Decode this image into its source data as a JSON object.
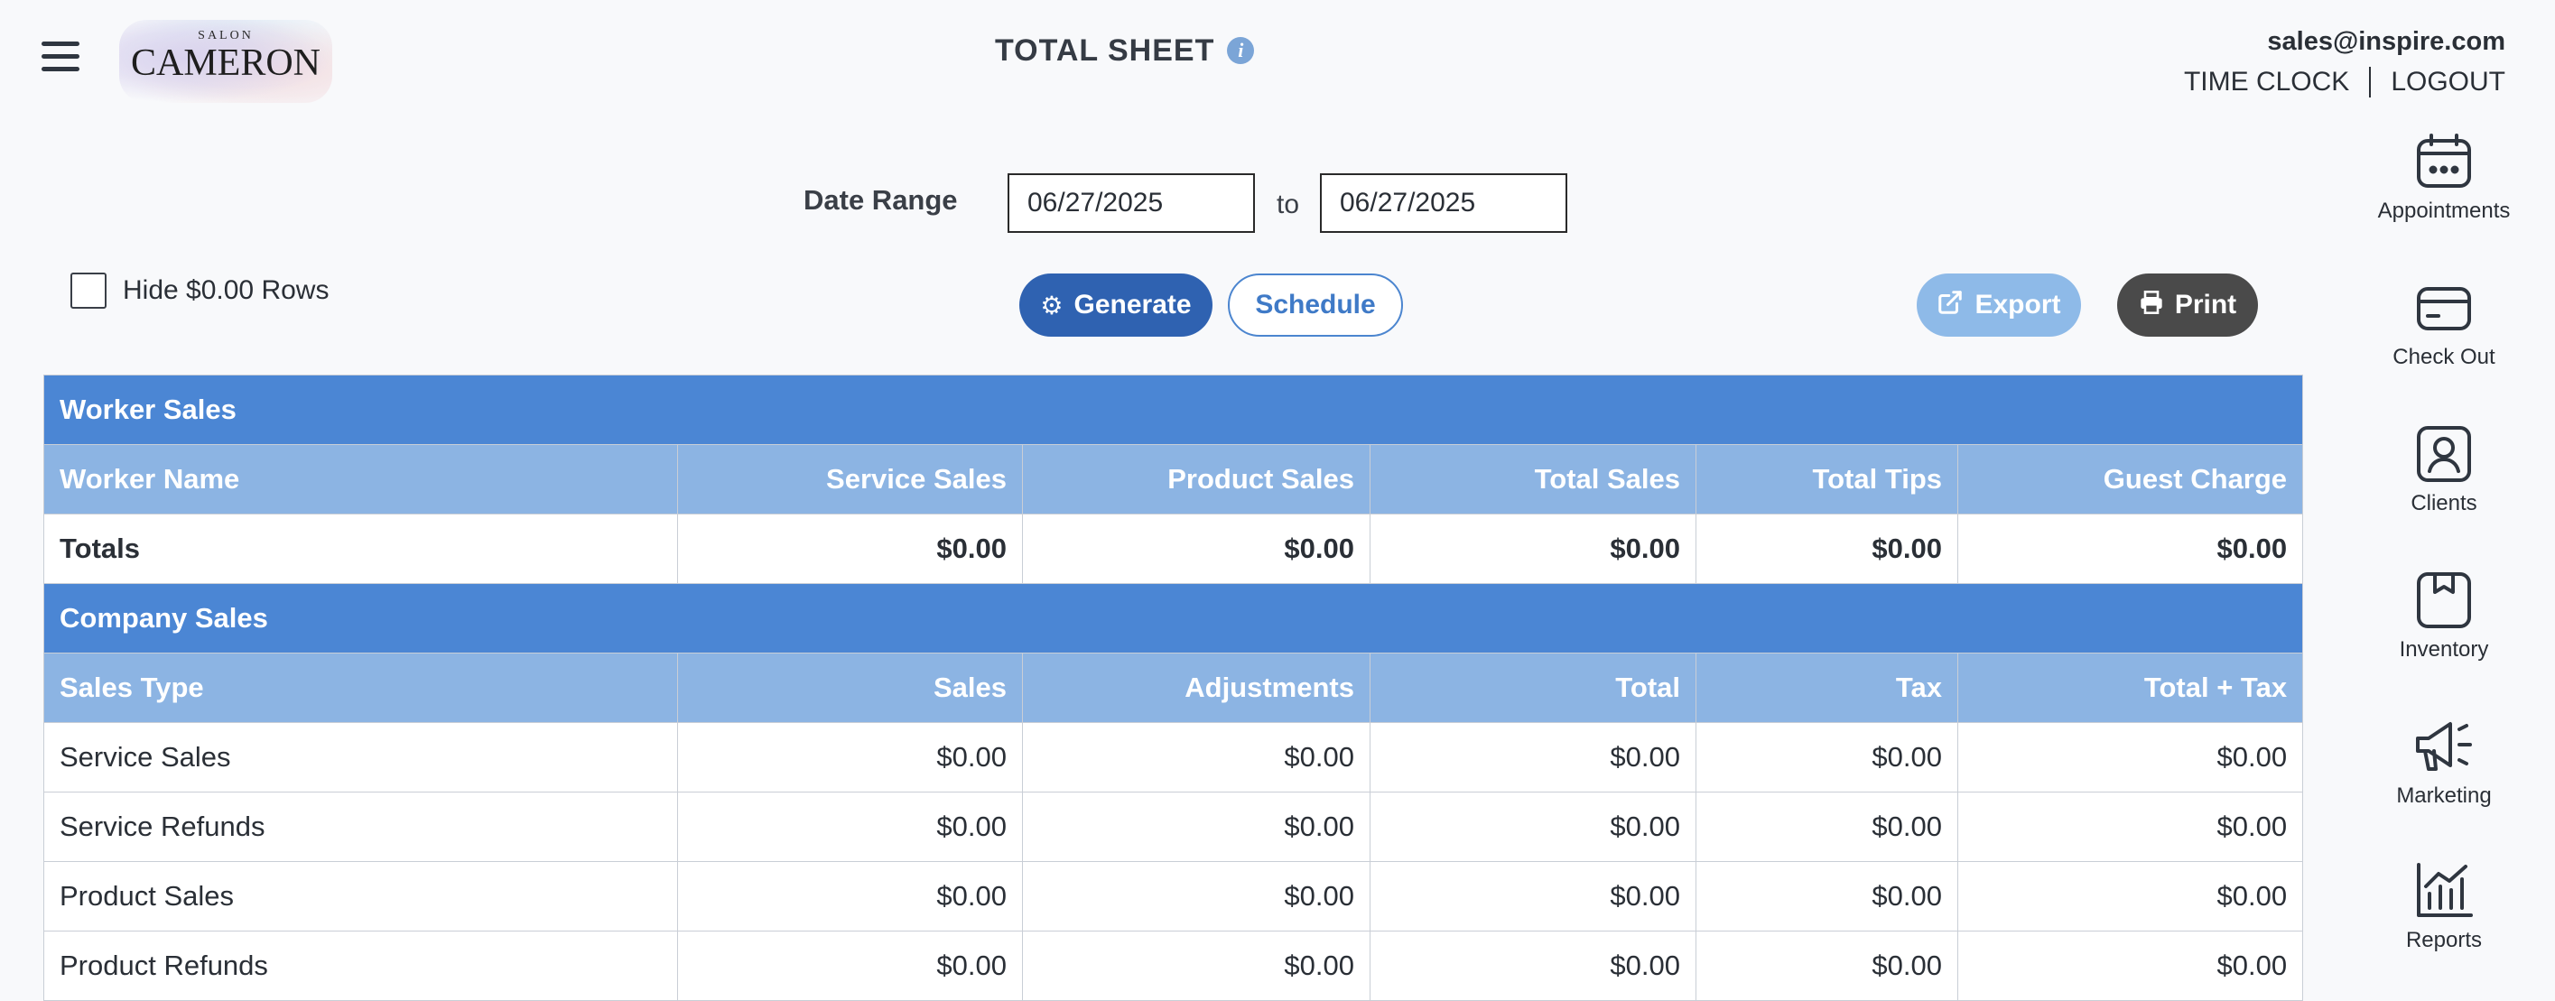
{
  "header": {
    "logo_small": "SALON",
    "logo_big": "CAMERON",
    "page_title": "TOTAL SHEET",
    "info_glyph": "i",
    "user_email": "sales@inspire.com",
    "time_clock": "TIME CLOCK",
    "logout": "LOGOUT"
  },
  "filters": {
    "date_range_label": "Date Range",
    "date_from": "06/27/2025",
    "to_label": "to",
    "date_to": "06/27/2025",
    "hide_zero_label": "Hide $0.00 Rows",
    "hide_zero_checked": false
  },
  "actions": {
    "generate": "Generate",
    "schedule": "Schedule",
    "export": "Export",
    "print": "Print"
  },
  "nav": [
    {
      "label": "Appointments",
      "icon": "calendar-icon"
    },
    {
      "label": "Check Out",
      "icon": "credit-card-icon"
    },
    {
      "label": "Clients",
      "icon": "client-icon"
    },
    {
      "label": "Inventory",
      "icon": "box-icon"
    },
    {
      "label": "Marketing",
      "icon": "megaphone-icon"
    },
    {
      "label": "Reports",
      "icon": "chart-icon"
    }
  ],
  "worker_sales": {
    "section_title": "Worker Sales",
    "columns": [
      "Worker Name",
      "Service Sales",
      "Product Sales",
      "Total Sales",
      "Total Tips",
      "Guest Charge"
    ],
    "totals": [
      "Totals",
      "$0.00",
      "$0.00",
      "$0.00",
      "$0.00",
      "$0.00"
    ]
  },
  "company_sales": {
    "section_title": "Company Sales",
    "columns": [
      "Sales Type",
      "Sales",
      "Adjustments",
      "Total",
      "Tax",
      "Total + Tax"
    ],
    "rows": [
      [
        "Service Sales",
        "$0.00",
        "$0.00",
        "$0.00",
        "$0.00",
        "$0.00"
      ],
      [
        "Service Refunds",
        "$0.00",
        "$0.00",
        "$0.00",
        "$0.00",
        "$0.00"
      ],
      [
        "Product Sales",
        "$0.00",
        "$0.00",
        "$0.00",
        "$0.00",
        "$0.00"
      ],
      [
        "Product Refunds",
        "$0.00",
        "$0.00",
        "$0.00",
        "$0.00",
        "$0.00"
      ]
    ]
  },
  "colors": {
    "section_header": "#4b86d4",
    "column_header": "#8cb4e3",
    "generate_button": "#2f62b1",
    "export_button": "#8ebae8",
    "print_button": "#4a4a4a"
  }
}
